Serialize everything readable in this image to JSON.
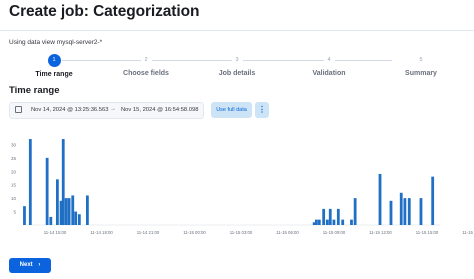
{
  "page": {
    "title": "Create job: Categorization"
  },
  "data_view": {
    "text": "Using data view mysql-server2-*"
  },
  "steps": [
    {
      "number": "1",
      "label": "Time range",
      "active": true
    },
    {
      "number": "2",
      "label": "Choose fields",
      "active": false
    },
    {
      "number": "3",
      "label": "Job details",
      "active": false
    },
    {
      "number": "4",
      "label": "Validation",
      "active": false
    },
    {
      "number": "5",
      "label": "Summary",
      "active": false
    }
  ],
  "section": {
    "title": "Time range"
  },
  "date_range": {
    "start": "Nov 14, 2024 @ 13:25:36.563",
    "end": "Nov 15, 2024 @ 16:54:58.098",
    "separator": "→"
  },
  "buttons": {
    "use_full_data": "Use full data",
    "more": "⋮",
    "next": "Next"
  },
  "chart_data": {
    "type": "bar",
    "ylim": [
      0,
      35
    ],
    "y_ticks": [
      5,
      10,
      15,
      20,
      25,
      30
    ],
    "x_ticks": [
      "11-14 15:00",
      "11-14 18:00",
      "11-14 21:00",
      "11-15 00:00",
      "11-15 03:00",
      "11-15 06:00",
      "11-15 09:00",
      "11-15 12:00",
      "11-15 15:00",
      "11-15 18:00"
    ],
    "color": "#1f6fc5",
    "bars": [
      {
        "x": 0.2,
        "y": 7
      },
      {
        "x": 1.0,
        "y": 32
      },
      {
        "x": 3.3,
        "y": 25
      },
      {
        "x": 3.8,
        "y": 3
      },
      {
        "x": 4.7,
        "y": 17
      },
      {
        "x": 5.2,
        "y": 9
      },
      {
        "x": 5.5,
        "y": 32
      },
      {
        "x": 5.9,
        "y": 10
      },
      {
        "x": 6.3,
        "y": 10
      },
      {
        "x": 6.8,
        "y": 11
      },
      {
        "x": 7.2,
        "y": 5
      },
      {
        "x": 7.7,
        "y": 4
      },
      {
        "x": 8.8,
        "y": 11
      },
      {
        "x": 39.8,
        "y": 1
      },
      {
        "x": 40.1,
        "y": 2
      },
      {
        "x": 40.5,
        "y": 2
      },
      {
        "x": 41.1,
        "y": 6
      },
      {
        "x": 41.6,
        "y": 2
      },
      {
        "x": 42.0,
        "y": 6
      },
      {
        "x": 42.5,
        "y": 2
      },
      {
        "x": 43.1,
        "y": 6
      },
      {
        "x": 43.7,
        "y": 2
      },
      {
        "x": 44.9,
        "y": 2
      },
      {
        "x": 45.4,
        "y": 10
      },
      {
        "x": 48.8,
        "y": 19
      },
      {
        "x": 50.3,
        "y": 9
      },
      {
        "x": 51.7,
        "y": 12
      },
      {
        "x": 52.2,
        "y": 10
      },
      {
        "x": 52.8,
        "y": 10
      },
      {
        "x": 54.4,
        "y": 10
      },
      {
        "x": 56.0,
        "y": 18
      }
    ],
    "x_domain": [
      0,
      57
    ]
  }
}
